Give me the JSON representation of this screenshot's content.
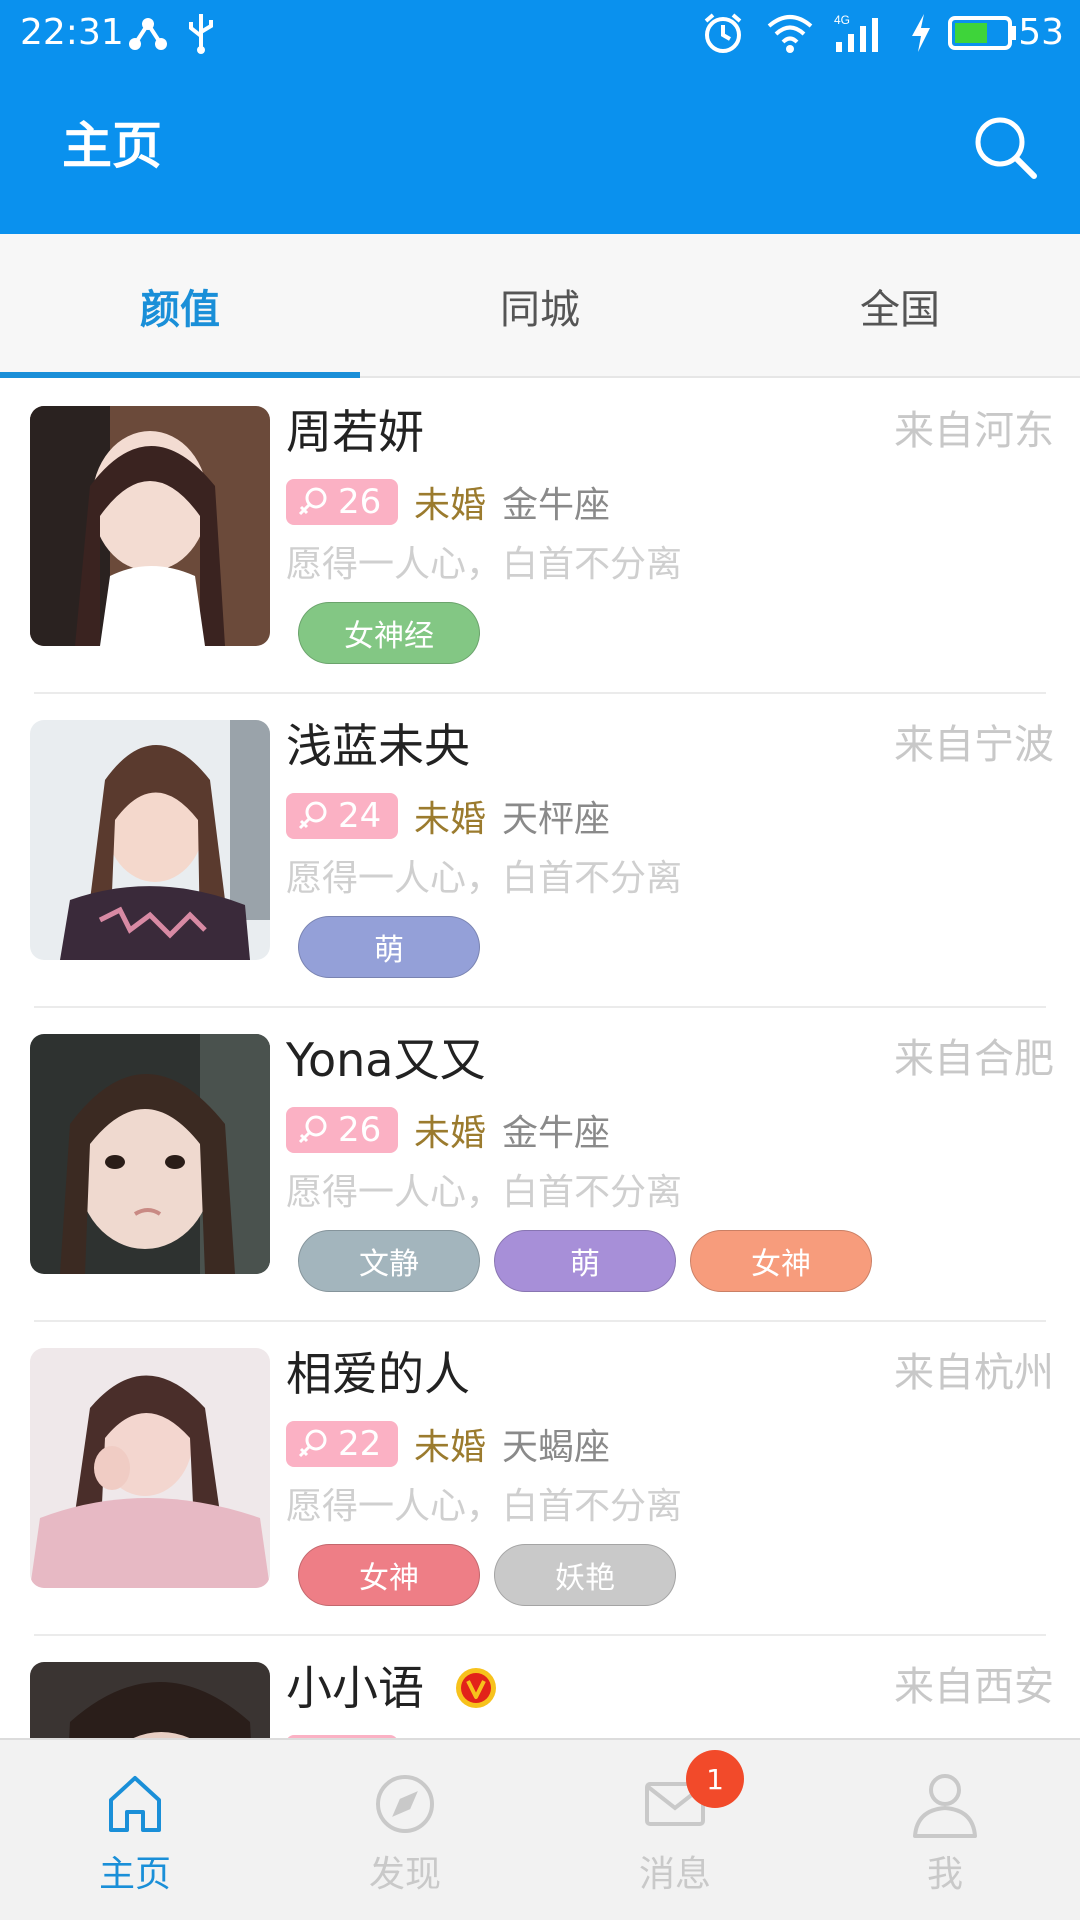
{
  "status_bar": {
    "time": "22:31",
    "battery": "53",
    "network": "4G"
  },
  "app_bar": {
    "title": "主页"
  },
  "tabs": [
    {
      "label": "颜值",
      "active": true
    },
    {
      "label": "同城",
      "active": false
    },
    {
      "label": "全国",
      "active": false
    }
  ],
  "list": [
    {
      "name": "周若妍",
      "from": "来自河东",
      "age": "26",
      "marital": "未婚",
      "zodiac": "金牛座",
      "motto": "愿得一人心，白首不分离",
      "tags": [
        {
          "label": "女神经",
          "color": "#83c784"
        }
      ]
    },
    {
      "name": "浅蓝未央",
      "from": "来自宁波",
      "age": "24",
      "marital": "未婚",
      "zodiac": "天枰座",
      "motto": "愿得一人心，白首不分离",
      "tags": [
        {
          "label": "萌",
          "color": "#94a0d8"
        }
      ]
    },
    {
      "name": "Yona又又",
      "from": "来自合肥",
      "age": "26",
      "marital": "未婚",
      "zodiac": "金牛座",
      "motto": "愿得一人心，白首不分离",
      "tags": [
        {
          "label": "文静",
          "color": "#a3b5bd"
        },
        {
          "label": "萌",
          "color": "#a78fd8"
        },
        {
          "label": "女神",
          "color": "#f79c7c"
        }
      ]
    },
    {
      "name": "相爱的人",
      "from": "来自杭州",
      "age": "22",
      "marital": "未婚",
      "zodiac": "天蝎座",
      "motto": "愿得一人心，白首不分离",
      "tags": [
        {
          "label": "女神",
          "color": "#ee7e86"
        },
        {
          "label": "妖艳",
          "color": "#c9c9c9"
        }
      ]
    },
    {
      "name": "小小语",
      "from": "来自西安",
      "age": "",
      "marital": "",
      "zodiac": "",
      "motto": "",
      "vip": true,
      "tags": []
    }
  ],
  "bottom_nav": [
    {
      "label": "主页",
      "icon": "home-icon",
      "active": true
    },
    {
      "label": "发现",
      "icon": "compass-icon",
      "active": false
    },
    {
      "label": "消息",
      "icon": "mail-icon",
      "active": false,
      "badge": "1"
    },
    {
      "label": "我",
      "icon": "person-icon",
      "active": false
    }
  ],
  "colors": {
    "primary": "#0a91ee",
    "accent": "#1a8fd8",
    "age_badge": "#fbb1c4",
    "badge_red": "#f24a2a"
  }
}
